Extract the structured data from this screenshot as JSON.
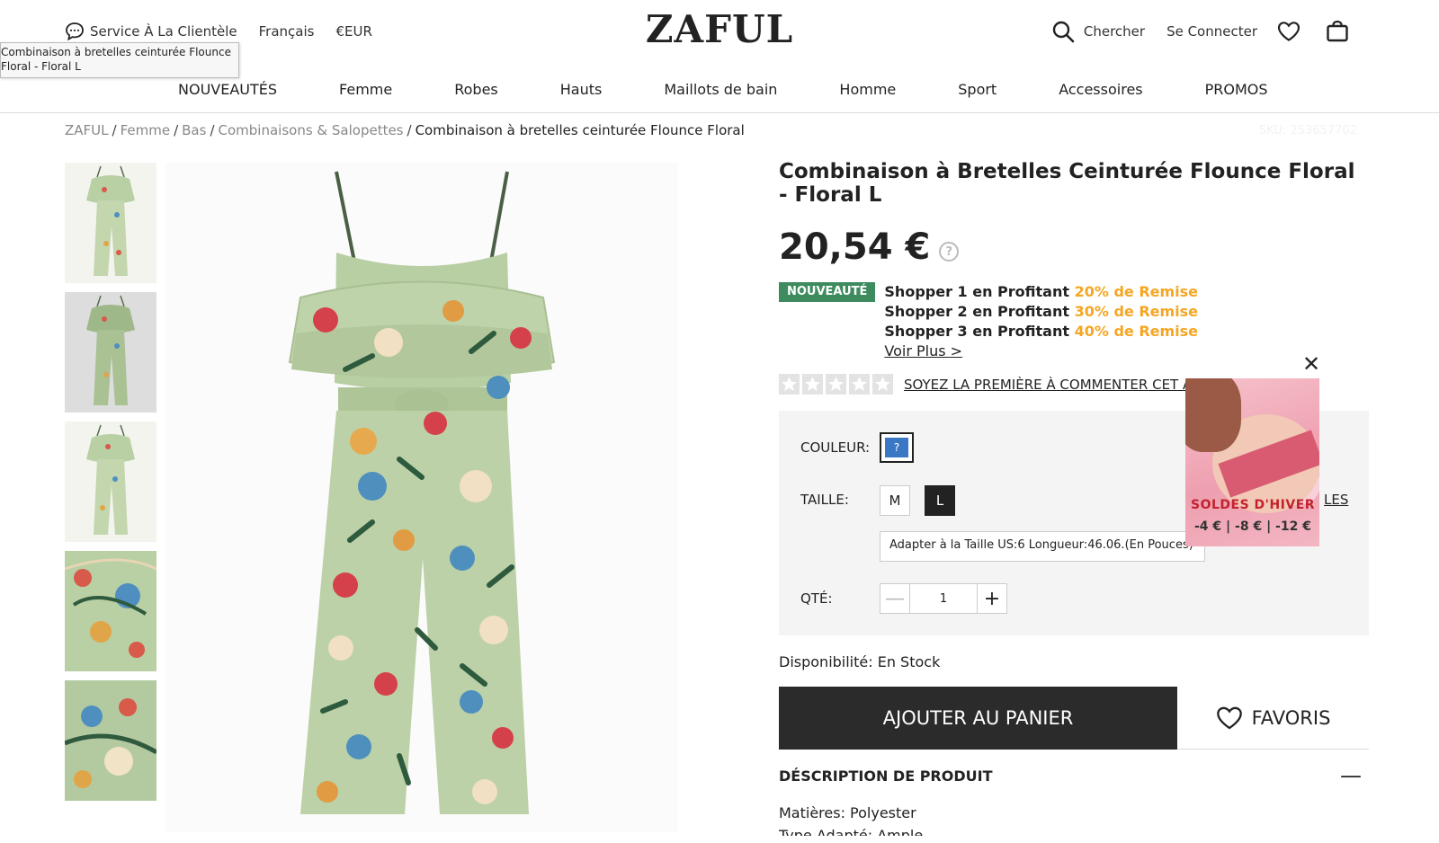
{
  "header": {
    "customer_service": "Service À La Clientèle",
    "language": "Français",
    "currency": "€EUR",
    "logo": "ZAFUL",
    "search_label": "Chercher",
    "login_label": "Se Connecter"
  },
  "tooltip": {
    "text": "Combinaison à bretelles ceinturée Flounce\nFloral - Floral L"
  },
  "nav": {
    "items": [
      "NOUVEAUTÉS",
      "Femme",
      "Robes",
      "Hauts",
      "Maillots de bain",
      "Homme",
      "Sport",
      "Accessoires",
      "PROMOS"
    ]
  },
  "breadcrumb": {
    "items": [
      "ZAFUL",
      "Femme",
      "Bas",
      "Combinaisons & Salopettes"
    ],
    "separator": "/",
    "current": "Combinaison à bretelles ceinturée Flounce Floral"
  },
  "sku": "SKU: 253657702",
  "product": {
    "title": "Combinaison à Bretelles Ceinturée Flounce Floral - Floral L",
    "price": "20,54 €",
    "price_help": "?",
    "badge": "NOUVEAUTÉ",
    "promos": [
      {
        "text": "Shopper 1 en Profitant ",
        "discount": "20% de Remise"
      },
      {
        "text": "Shopper 2 en Profitant ",
        "discount": "30% de Remise"
      },
      {
        "text": "Shopper 3 en Profitant ",
        "discount": "40% de Remise"
      }
    ],
    "voir_plus": "Voir Plus >",
    "review_link": "SOYEZ LA PREMIÈRE À COMMENTER CET ARTICLE",
    "rating": 0,
    "color_label": "COULEUR:",
    "color_swatch": "?",
    "size_label": "TAILLE:",
    "sizes": [
      "M",
      "L"
    ],
    "selected_size": "L",
    "size_guide": "LES",
    "fit_text": "Adapter à la Taille US:6   Longueur:46.06.(En Pouces)",
    "qty_label": "QTÉ:",
    "qty_value": "1",
    "availability": "Disponibilité: En Stock",
    "add_to_cart": "AJOUTER AU PANIER",
    "favorites": "FAVORIS",
    "description_header": "DÉSCRIPTION DE PRODUIT",
    "description_toggle": "—",
    "materials": "Matières: Polyester",
    "fit_type": "Type Adapté: Ample"
  },
  "popup": {
    "title": "SOLDES D'HIVER",
    "prices": "-4 € | -8 € | -12 €",
    "close": "✕"
  },
  "colors": {
    "accent_orange": "#f5a623",
    "badge_green": "#3d8b5e",
    "cta_dark": "#2b2b2b",
    "swatch_blue": "#3a78c5",
    "popup_red": "#c2222e"
  }
}
